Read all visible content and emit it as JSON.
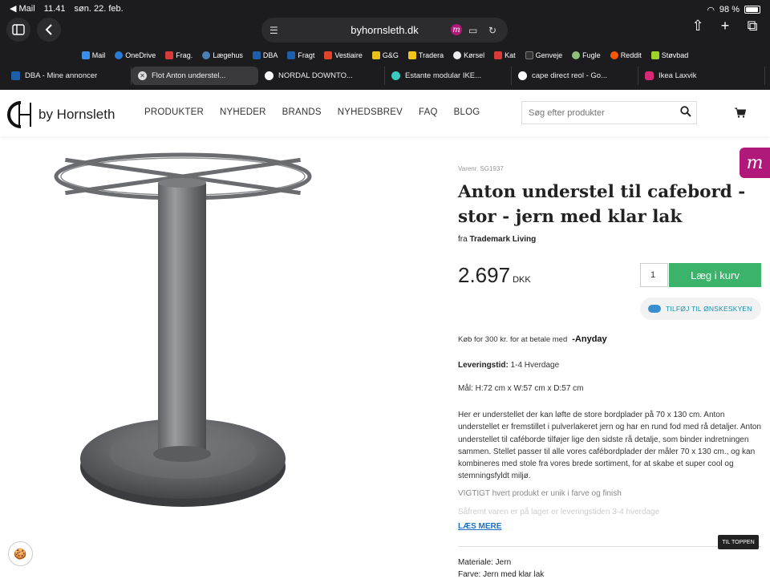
{
  "status_bar": {
    "back_app": "◀ Mail",
    "time": "11.41",
    "date": "søn. 22. feb.",
    "battery": "98 %"
  },
  "browser": {
    "url": "byhornsleth.dk",
    "bookmarks": [
      "Mail",
      "OneDrive",
      "Frag.",
      "Lægehus",
      "DBA",
      "Fragt",
      "Vestiaire",
      "G&G",
      "Tradera",
      "Kørsel",
      "Kat",
      "Genveje",
      "Fugle",
      "Reddit",
      "Støvbad"
    ],
    "tabs": [
      {
        "label": "DBA - Mine annoncer",
        "active": false
      },
      {
        "label": "Flot Anton understel...",
        "active": true
      },
      {
        "label": "NORDAL DOWNTO...",
        "active": false
      },
      {
        "label": "Estante modular IKE...",
        "active": false
      },
      {
        "label": "cape direct reol - Go...",
        "active": false
      },
      {
        "label": "Ikea Laxvik",
        "active": false
      }
    ],
    "icons": {
      "sidebar": "sidebar-icon",
      "back": "chevron-left-icon",
      "share": "share-icon",
      "new_tab": "plus-icon",
      "tabs": "tabs-icon"
    }
  },
  "site": {
    "logo_text": "by Hornsleth",
    "nav": [
      "PRODUKTER",
      "NYHEDER",
      "BRANDS",
      "NYHEDSBREV",
      "FAQ",
      "BLOG"
    ],
    "search_placeholder": "Søg efter produkter"
  },
  "product": {
    "sku": "Varenr. SG1937",
    "title": "Anton understel til cafebord - stor - jern med klar lak",
    "brand_prefix": "fra",
    "brand": "Trademark Living",
    "price": "2.697",
    "currency": "DKK",
    "qty": "1",
    "add_to_cart": "Læg i kurv",
    "wishlist": "TILFØJ TIL ØNSKESKYEN",
    "anyday_text": "Køb for 300 kr. for at betale med",
    "anyday_brand": "-Anyday",
    "delivery_label": "Leveringstid:",
    "delivery_value": "1-4 Hverdage",
    "dims": "Mål: H:72 cm x W:57 cm x D:57 cm",
    "description": "Her er understellet der kan løfte de store bordplader på 70 x 130 cm. Anton understellet er fremstillet i pulverlakeret jern og har en rund fod med rå detaljer. Anton understellet til caféborde tilføjer lige den sidste rå detalje, som binder indretningen sammen. Stellet passer til alle vores cafébordplader der måler 70 x 130 cm., og kan kombineres med stole fra vores brede sortiment, for at skabe et super cool og stemningsfyldt miljø.",
    "note1": "VIGTIGT hvert produkt er unik i farve og finish",
    "note2": "Såfremt varen er på lager er leveringstiden 3-4 hverdage",
    "read_more": "LÆS MERE",
    "material": "Materiale: Jern",
    "color": "Farve: Jern med klar lak"
  },
  "to_top": "TIL TOPPEN"
}
